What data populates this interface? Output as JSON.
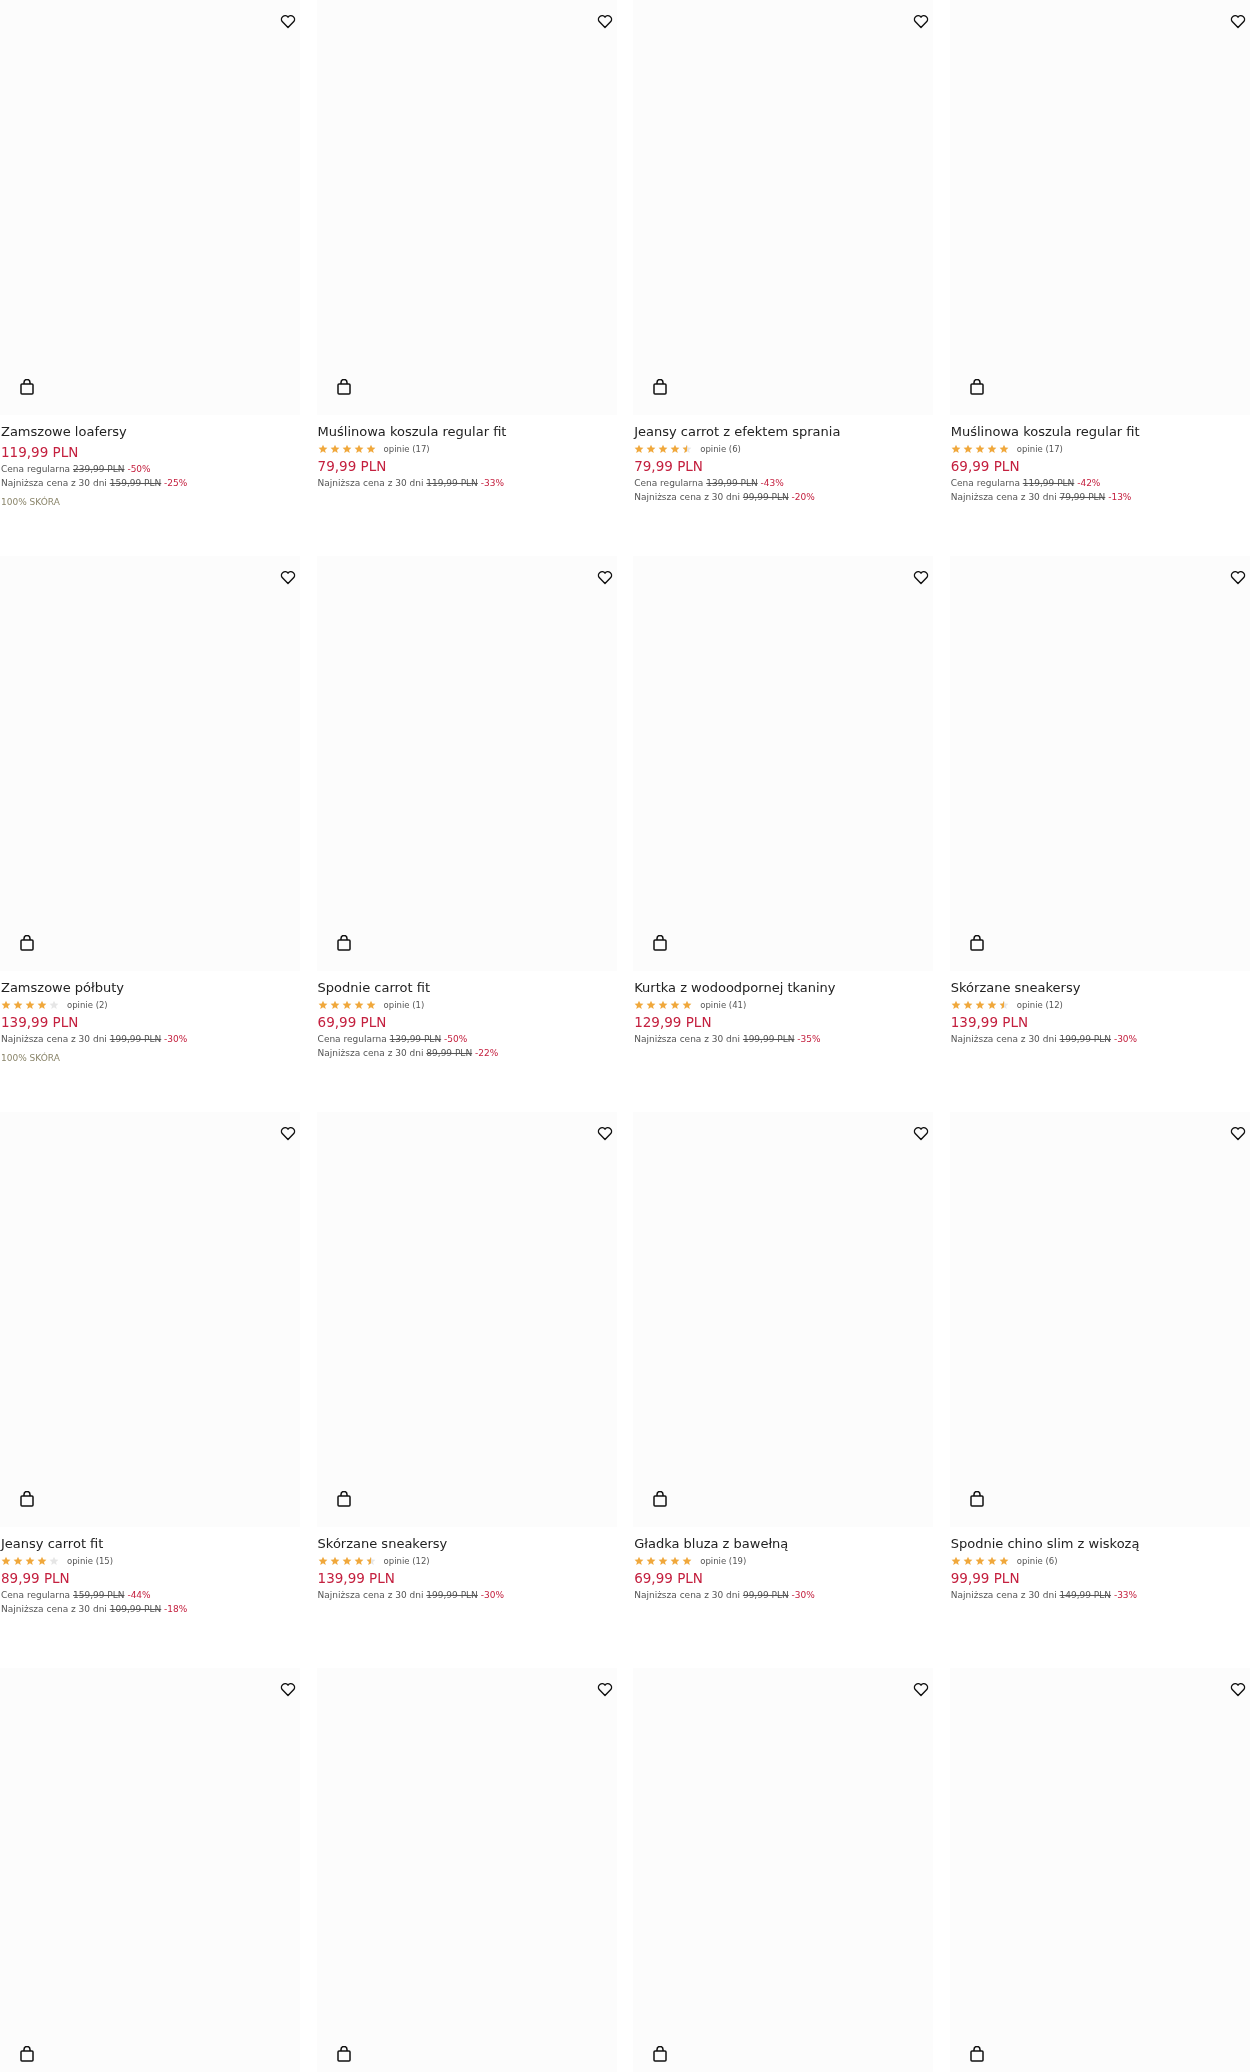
{
  "products": [
    {
      "name": "Zamszowe loafersy",
      "price": "119,99 PLN",
      "price_notes": [
        {
          "label": "Cena regularna",
          "old_price": "239,99 PLN",
          "discount": "-50%"
        },
        {
          "label": "Najniższa cena z 30 dni",
          "old_price": "159,99 PLN",
          "discount": "-25%"
        }
      ],
      "tag": "100% SKÓRA"
    },
    {
      "name": "Muślinowa koszula regular fit",
      "stars": 5,
      "reviews": "opinie (17)",
      "price": "79,99 PLN",
      "price_notes": [
        {
          "label": "Najniższa cena z 30 dni",
          "old_price": "119,99 PLN",
          "discount": "-33%"
        }
      ]
    },
    {
      "name": "Jeansy carrot z efektem sprania",
      "stars": 4.5,
      "reviews": "opinie (6)",
      "price": "79,99 PLN",
      "price_notes": [
        {
          "label": "Cena regularna",
          "old_price": "139,99 PLN",
          "discount": "-43%"
        },
        {
          "label": "Najniższa cena z 30 dni",
          "old_price": "99,99 PLN",
          "discount": "-20%"
        }
      ]
    },
    {
      "name": "Muślinowa koszula regular fit",
      "stars": 5,
      "reviews": "opinie (17)",
      "price": "69,99 PLN",
      "price_notes": [
        {
          "label": "Cena regularna",
          "old_price": "119,99 PLN",
          "discount": "-42%"
        },
        {
          "label": "Najniższa cena z 30 dni",
          "old_price": "79,99 PLN",
          "discount": "-13%"
        }
      ]
    },
    {
      "name": "Zamszowe półbuty",
      "stars": 4,
      "reviews": "opinie (2)",
      "price": "139,99 PLN",
      "price_notes": [
        {
          "label": "Najniższa cena z 30 dni",
          "old_price": "199,99 PLN",
          "discount": "-30%"
        }
      ],
      "tag": "100% SKÓRA"
    },
    {
      "name": "Spodnie carrot fit",
      "stars": 5,
      "reviews": "opinie (1)",
      "price": "69,99 PLN",
      "price_notes": [
        {
          "label": "Cena regularna",
          "old_price": "139,99 PLN",
          "discount": "-50%"
        },
        {
          "label": "Najniższa cena z 30 dni",
          "old_price": "89,99 PLN",
          "discount": "-22%"
        }
      ]
    },
    {
      "name": "Kurtka z wodoodpornej tkaniny",
      "stars": 5,
      "reviews": "opinie (41)",
      "price": "129,99 PLN",
      "price_notes": [
        {
          "label": "Najniższa cena z 30 dni",
          "old_price": "199,99 PLN",
          "discount": "-35%"
        }
      ]
    },
    {
      "name": "Skórzane sneakersy",
      "stars": 4.5,
      "reviews": "opinie (12)",
      "price": "139,99 PLN",
      "price_notes": [
        {
          "label": "Najniższa cena z 30 dni",
          "old_price": "199,99 PLN",
          "discount": "-30%"
        }
      ]
    },
    {
      "name": "Jeansy carrot fit",
      "stars": 4,
      "reviews": "opinie (15)",
      "price": "89,99 PLN",
      "price_notes": [
        {
          "label": "Cena regularna",
          "old_price": "159,99 PLN",
          "discount": "-44%"
        },
        {
          "label": "Najniższa cena z 30 dni",
          "old_price": "109,99 PLN",
          "discount": "-18%"
        }
      ]
    },
    {
      "name": "Skórzane sneakersy",
      "stars": 4.5,
      "reviews": "opinie (12)",
      "price": "139,99 PLN",
      "price_notes": [
        {
          "label": "Najniższa cena z 30 dni",
          "old_price": "199,99 PLN",
          "discount": "-30%"
        }
      ]
    },
    {
      "name": "Gładka bluza z bawełną",
      "stars": 5,
      "reviews": "opinie (19)",
      "price": "69,99 PLN",
      "price_notes": [
        {
          "label": "Najniższa cena z 30 dni",
          "old_price": "99,99 PLN",
          "discount": "-30%"
        }
      ]
    },
    {
      "name": "Spodnie chino slim z wiskozą",
      "stars": 5,
      "reviews": "opinie (6)",
      "price": "99,99 PLN",
      "price_notes": [
        {
          "label": "Najniższa cena z 30 dni",
          "old_price": "149,99 PLN",
          "discount": "-33%"
        }
      ]
    },
    {
      "kind": "image_only"
    },
    {
      "kind": "image_only"
    },
    {
      "kind": "image_only"
    },
    {
      "kind": "image_only"
    }
  ]
}
